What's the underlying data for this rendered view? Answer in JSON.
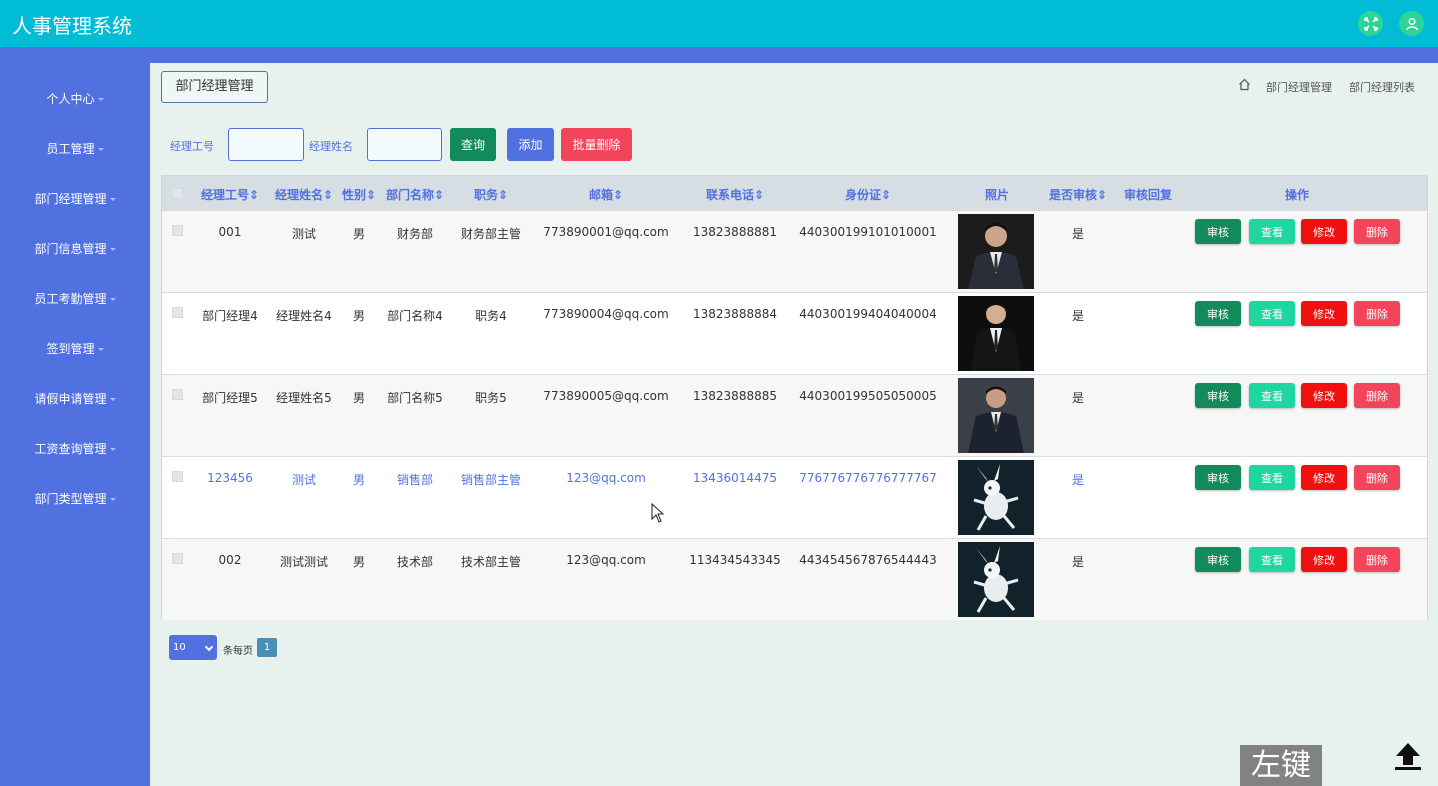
{
  "app": {
    "title": "人事管理系统"
  },
  "topbar": {
    "fullscreen_icon": "expand-icon",
    "user_icon": "user-icon"
  },
  "sidebar": {
    "items": [
      {
        "label": "个人中心"
      },
      {
        "label": "员工管理"
      },
      {
        "label": "部门经理管理"
      },
      {
        "label": "部门信息管理"
      },
      {
        "label": "员工考勤管理"
      },
      {
        "label": "签到管理"
      },
      {
        "label": "请假申请管理"
      },
      {
        "label": "工资查询管理"
      },
      {
        "label": "部门类型管理"
      }
    ]
  },
  "page": {
    "tab_title": "部门经理管理",
    "breadcrumb": [
      "部门经理管理",
      "部门经理列表"
    ]
  },
  "search": {
    "manager_id_label": "经理工号",
    "manager_id_value": "",
    "manager_name_label": "经理姓名",
    "manager_name_value": "",
    "query_button": "查询",
    "add_button": "添加",
    "batch_delete_button": "批量删除"
  },
  "table": {
    "columns": [
      "经理工号",
      "经理姓名",
      "性别",
      "部门名称",
      "职务",
      "邮箱",
      "联系电话",
      "身份证",
      "照片",
      "是否审核",
      "审核回复",
      "操作"
    ],
    "rows": [
      {
        "id": "001",
        "name": "测试",
        "gender": "男",
        "dept": "财务部",
        "title": "财务部主管",
        "email": "773890001@qq.com",
        "phone": "13823888881",
        "idcard": "440300199101010001",
        "photo": "man-in-suit-photo",
        "audited": "是",
        "reply": ""
      },
      {
        "id": "部门经理4",
        "name": "经理姓名4",
        "gender": "男",
        "dept": "部门名称4",
        "title": "职务4",
        "email": "773890004@qq.com",
        "phone": "13823888884",
        "idcard": "440300199404040004",
        "photo": "man-in-suit-photo",
        "audited": "是",
        "reply": ""
      },
      {
        "id": "部门经理5",
        "name": "经理姓名5",
        "gender": "男",
        "dept": "部门名称5",
        "title": "职务5",
        "email": "773890005@qq.com",
        "phone": "13823888885",
        "idcard": "440300199505050005",
        "photo": "man-in-suit-photo",
        "audited": "是",
        "reply": ""
      },
      {
        "id": "123456",
        "name": "测试",
        "gender": "男",
        "dept": "销售部",
        "title": "销售部主管",
        "email": "123@qq.com",
        "phone": "13436014475",
        "idcard": "776776776776777767",
        "photo": "white-creature-photo",
        "audited": "是",
        "reply": ""
      },
      {
        "id": "002",
        "name": "测试测试",
        "gender": "男",
        "dept": "技术部",
        "title": "技术部主管",
        "email": "123@qq.com",
        "phone": "113434543345",
        "idcard": "443454567876544443",
        "photo": "white-creature-photo",
        "audited": "是",
        "reply": ""
      }
    ],
    "actions": {
      "audit": "审核",
      "view": "查看",
      "edit": "修改",
      "delete": "删除"
    }
  },
  "pagination": {
    "page_size": "10",
    "per_page_label": "条每页",
    "current_page": "1"
  },
  "overlay": {
    "key_hint": "左键"
  },
  "colors": {
    "topbar": "#00bcd4",
    "sidebar": "#5271e0",
    "content_bg": "#e7f2ee",
    "audit": "#138a5c",
    "view": "#1fd6a0",
    "edit": "#f01010",
    "delete": "#f2445a",
    "query": "#138a5c",
    "add": "#5271e0",
    "batch_delete": "#f2445a"
  }
}
